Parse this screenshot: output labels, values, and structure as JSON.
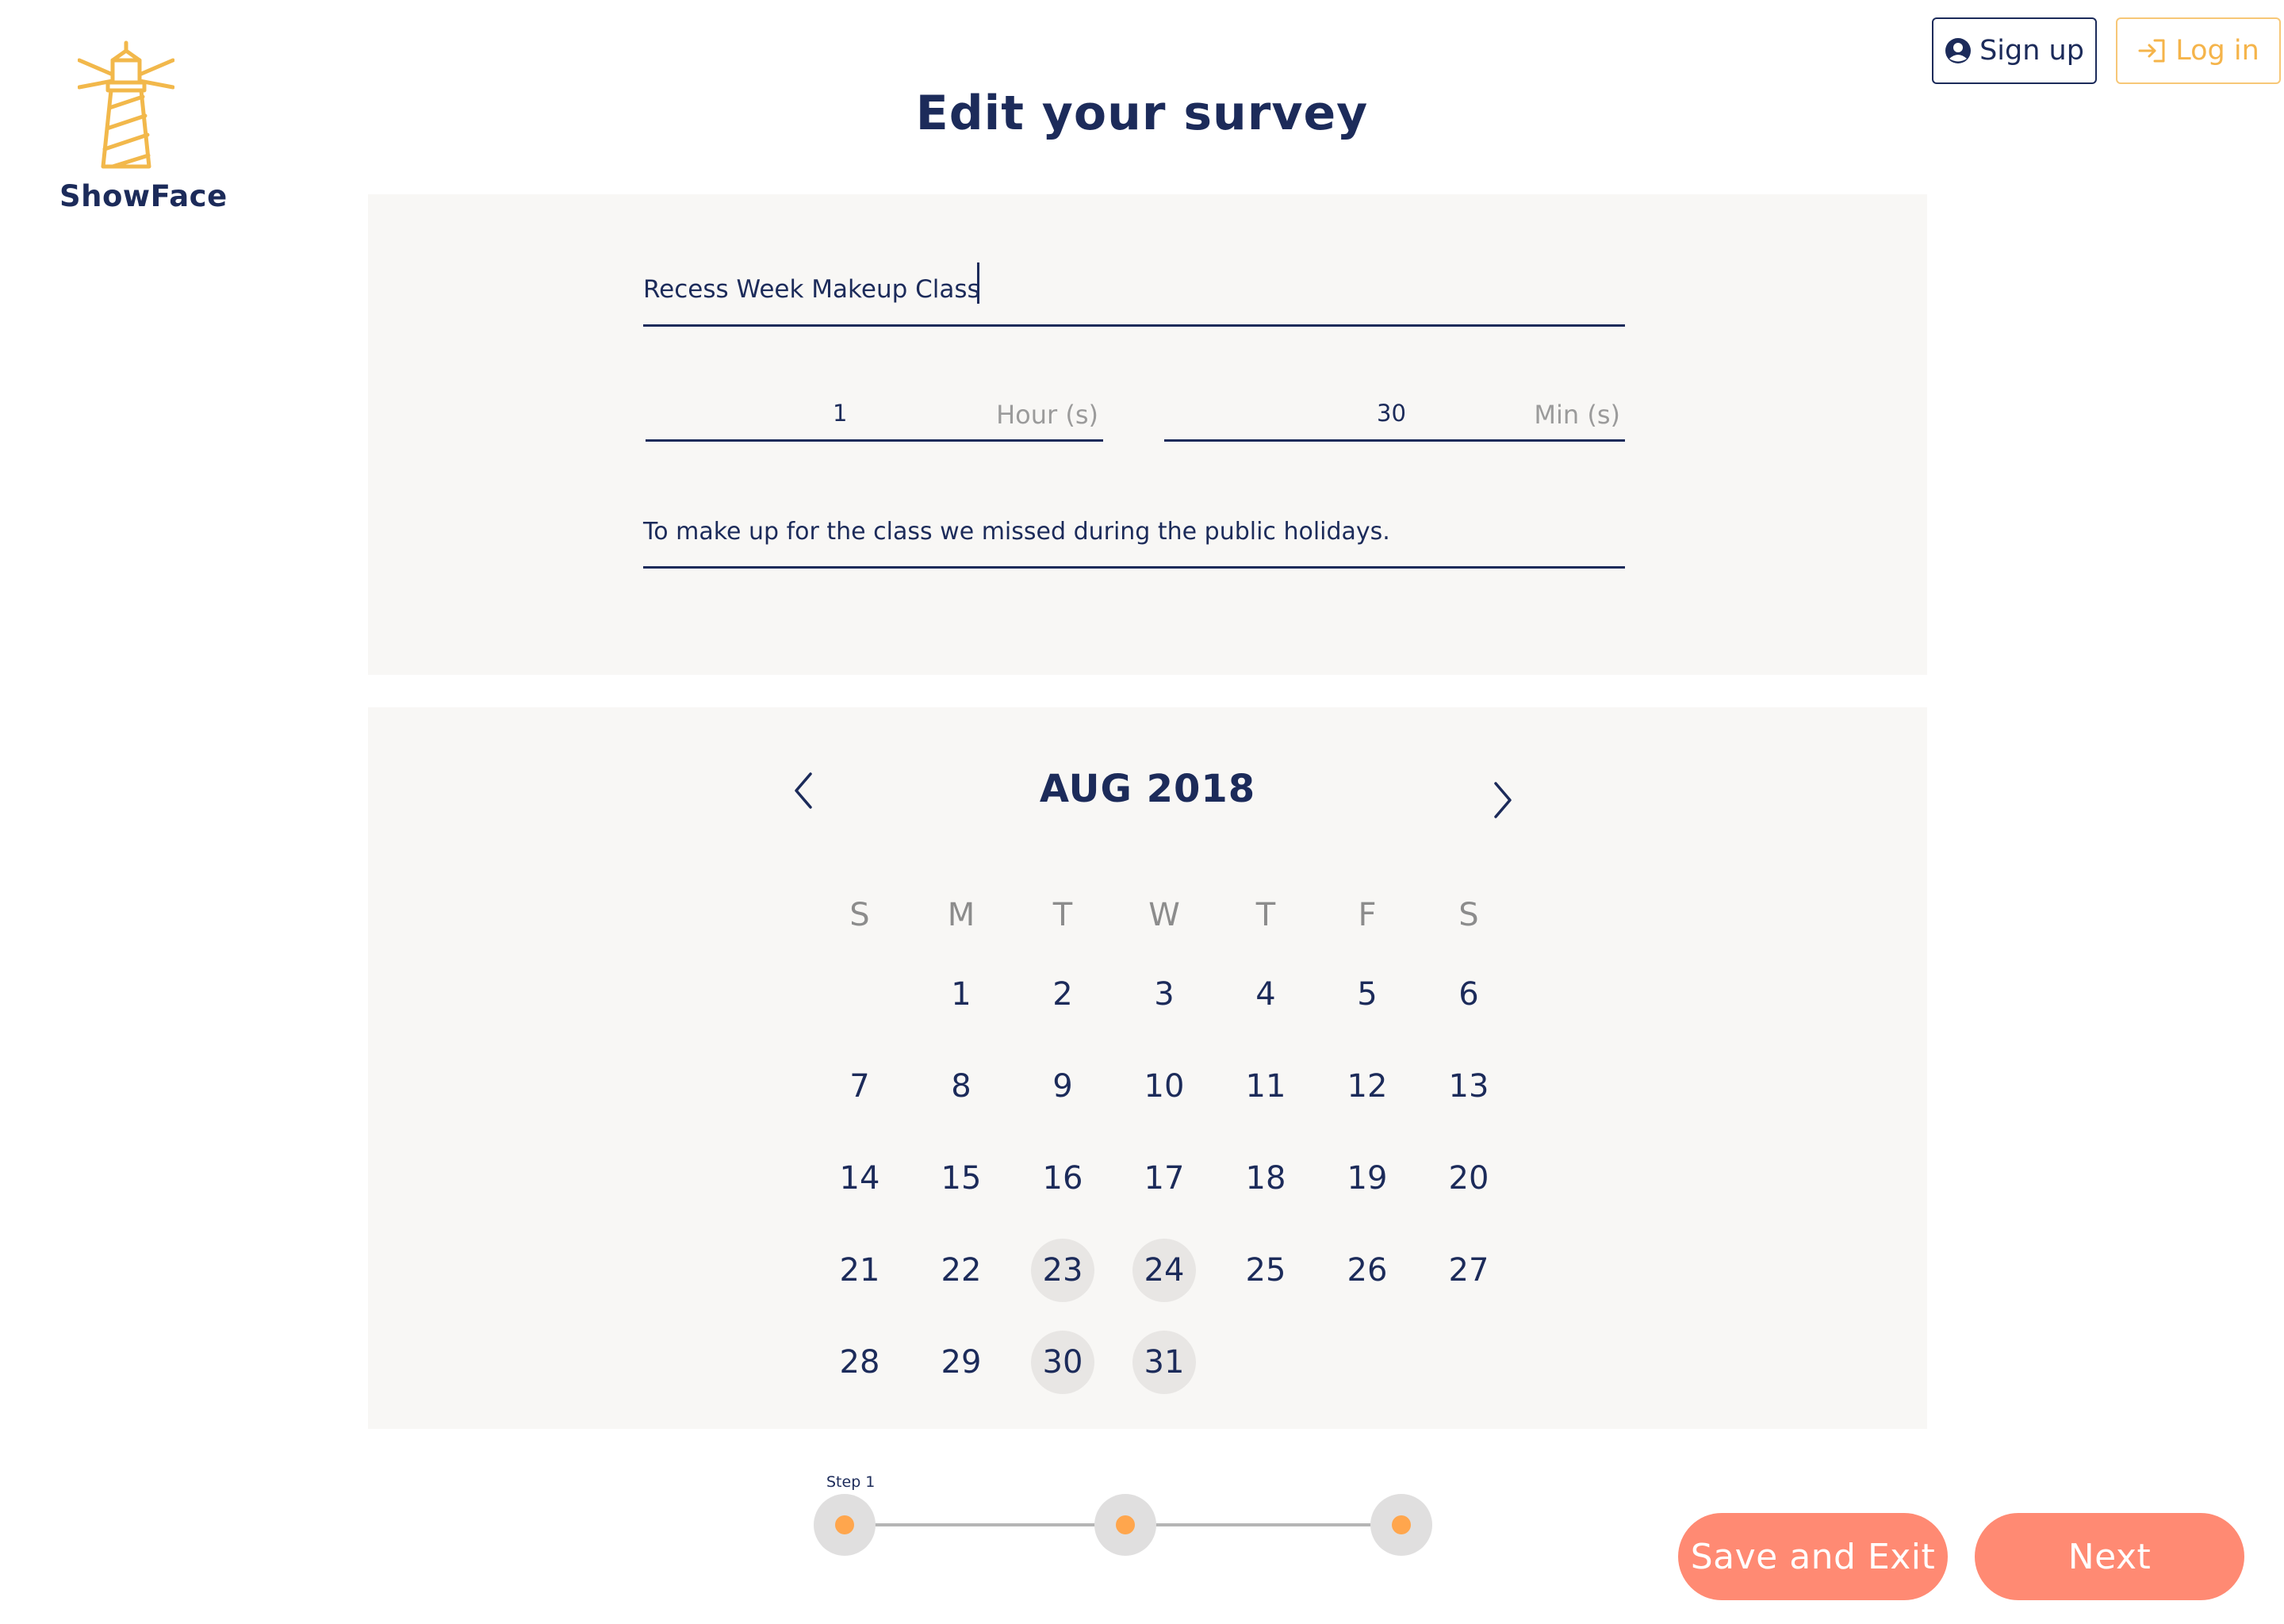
{
  "brand": {
    "name": "ShowFace"
  },
  "header": {
    "signup_label": "Sign up",
    "login_label": "Log in"
  },
  "page": {
    "title": "Edit your survey"
  },
  "form": {
    "title_value": "Recess Week Makeup Class",
    "hours_value": "1",
    "hours_unit": "Hour (s)",
    "minutes_value": "30",
    "minutes_unit": "Min (s)",
    "description_value": "To make up for the class we missed during the public holidays."
  },
  "calendar": {
    "month_label": "AUG 2018",
    "weekdays": [
      "S",
      "M",
      "T",
      "W",
      "T",
      "F",
      "S"
    ],
    "leading_blanks": 1,
    "days_in_month": 31,
    "selected_days": [
      23,
      24,
      30,
      31
    ]
  },
  "stepper": {
    "step_label": "Step 1",
    "steps": 3,
    "current_step": 1
  },
  "actions": {
    "save_exit_label": "Save and Exit",
    "next_label": "Next"
  },
  "colors": {
    "primary": "#1c2b5a",
    "accent": "#f5b44a",
    "button": "#ff8a73",
    "panel": "#f8f7f5",
    "selected_day": "#e8e6e4",
    "step_dot": "#ffa64d"
  },
  "icons": {
    "logo": "lighthouse-icon",
    "signup": "user-circle-icon",
    "login": "sign-in-icon",
    "prev": "chevron-left-icon",
    "next": "chevron-right-icon"
  }
}
